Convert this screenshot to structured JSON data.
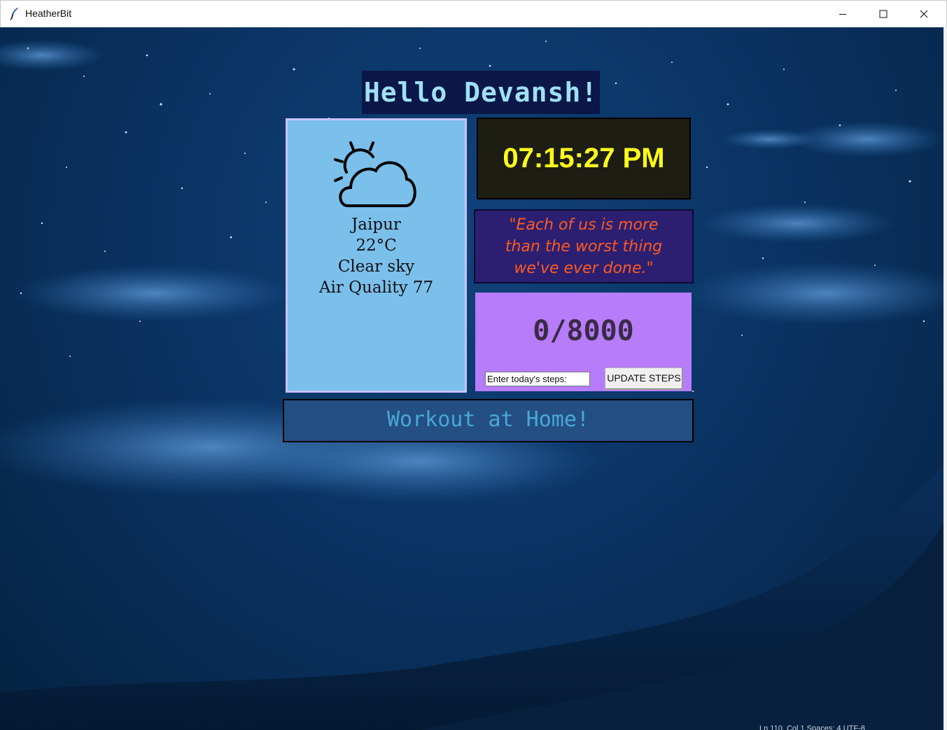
{
  "window": {
    "title": "HeatherBit",
    "icon": "feather-icon",
    "controls": [
      "minimize-icon",
      "maximize-icon",
      "close-icon"
    ]
  },
  "greeting": "Hello Devansh!",
  "weather": {
    "icon": "partly-sunny-icon",
    "city": "Jaipur",
    "temperature": "22°C",
    "condition": "Clear sky",
    "air_quality": "Air Quality 77"
  },
  "clock": {
    "time": "07:15:27 PM"
  },
  "quote": {
    "text": "\"Each of us is more than the worst thing we've ever done.\""
  },
  "steps": {
    "count": "0/8000",
    "input_value": "Enter today's steps:",
    "update_label": "UPDATE STEPS"
  },
  "workout": {
    "label": "Workout at Home!"
  },
  "status_peek": "Ln 110, Col 1   Spaces: 4   UTF-8",
  "colors": {
    "greeting_bg": "#0a1748",
    "greeting_text": "#9fe0f5",
    "weather_bg": "#7bbfeb",
    "clock_bg": "#1d1d14",
    "clock_text": "#ffff1a",
    "quote_bg": "#2c1f72",
    "quote_text": "#ff5a1f",
    "steps_bg": "#b67cfa",
    "workout_bg": "#234f82",
    "workout_text": "#4aa7d7"
  }
}
